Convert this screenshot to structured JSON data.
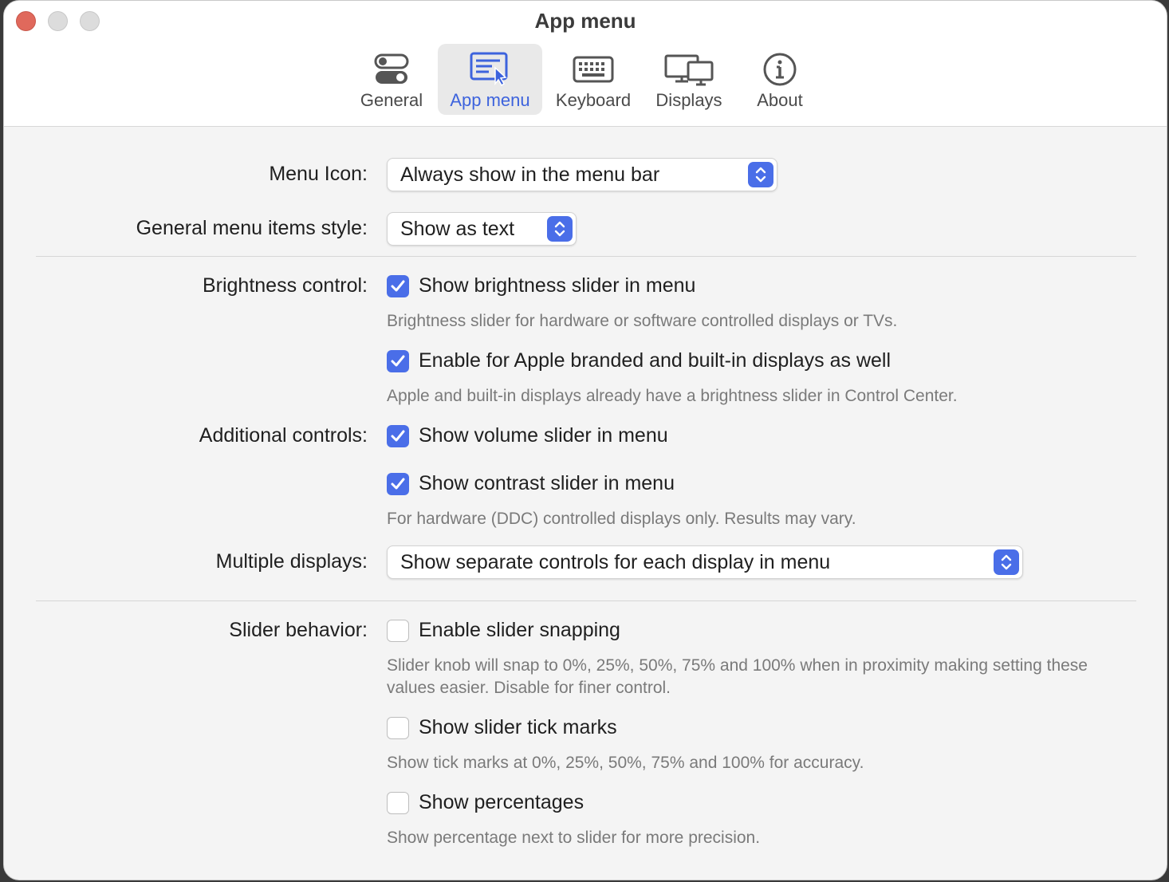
{
  "window": {
    "title": "App menu"
  },
  "tabs": [
    {
      "label": "General",
      "icon": "toggles-icon"
    },
    {
      "label": "App menu",
      "icon": "menu-cursor-icon",
      "selected": true
    },
    {
      "label": "Keyboard",
      "icon": "keyboard-icon"
    },
    {
      "label": "Displays",
      "icon": "displays-icon"
    },
    {
      "label": "About",
      "icon": "info-icon"
    }
  ],
  "settings": {
    "menu_icon": {
      "label": "Menu Icon:",
      "value": "Always show in the menu bar"
    },
    "menu_items_style": {
      "label": "General menu items style:",
      "value": "Show as text"
    },
    "brightness": {
      "label": "Brightness control:",
      "show_slider": {
        "label": "Show brightness slider in menu",
        "checked": true
      },
      "show_slider_help": "Brightness slider for hardware or software controlled displays or TVs.",
      "apple_displays": {
        "label": "Enable for Apple branded and built-in displays as well",
        "checked": true
      },
      "apple_displays_help": "Apple and built-in displays already have a brightness slider in Control Center."
    },
    "additional": {
      "label": "Additional controls:",
      "volume": {
        "label": "Show volume slider in menu",
        "checked": true
      },
      "contrast": {
        "label": "Show contrast slider in menu",
        "checked": true
      },
      "contrast_help": "For hardware (DDC) controlled displays only. Results may vary."
    },
    "multiple_displays": {
      "label": "Multiple displays:",
      "value": "Show separate controls for each display in menu"
    },
    "slider": {
      "label": "Slider behavior:",
      "snapping": {
        "label": "Enable slider snapping",
        "checked": false
      },
      "snapping_help": "Slider knob will snap to 0%, 25%, 50%, 75% and 100% when in proximity making setting these values easier. Disable for finer control.",
      "ticks": {
        "label": "Show slider tick marks",
        "checked": false
      },
      "ticks_help": "Show tick marks at 0%, 25%, 50%, 75% and 100% for accuracy.",
      "percentages": {
        "label": "Show percentages",
        "checked": false
      },
      "percentages_help": "Show percentage next to slider for more precision."
    }
  },
  "colors": {
    "accent": "#4a6ee8",
    "selected_tab_text": "#3d63dd",
    "close_button": "#e0695c"
  }
}
